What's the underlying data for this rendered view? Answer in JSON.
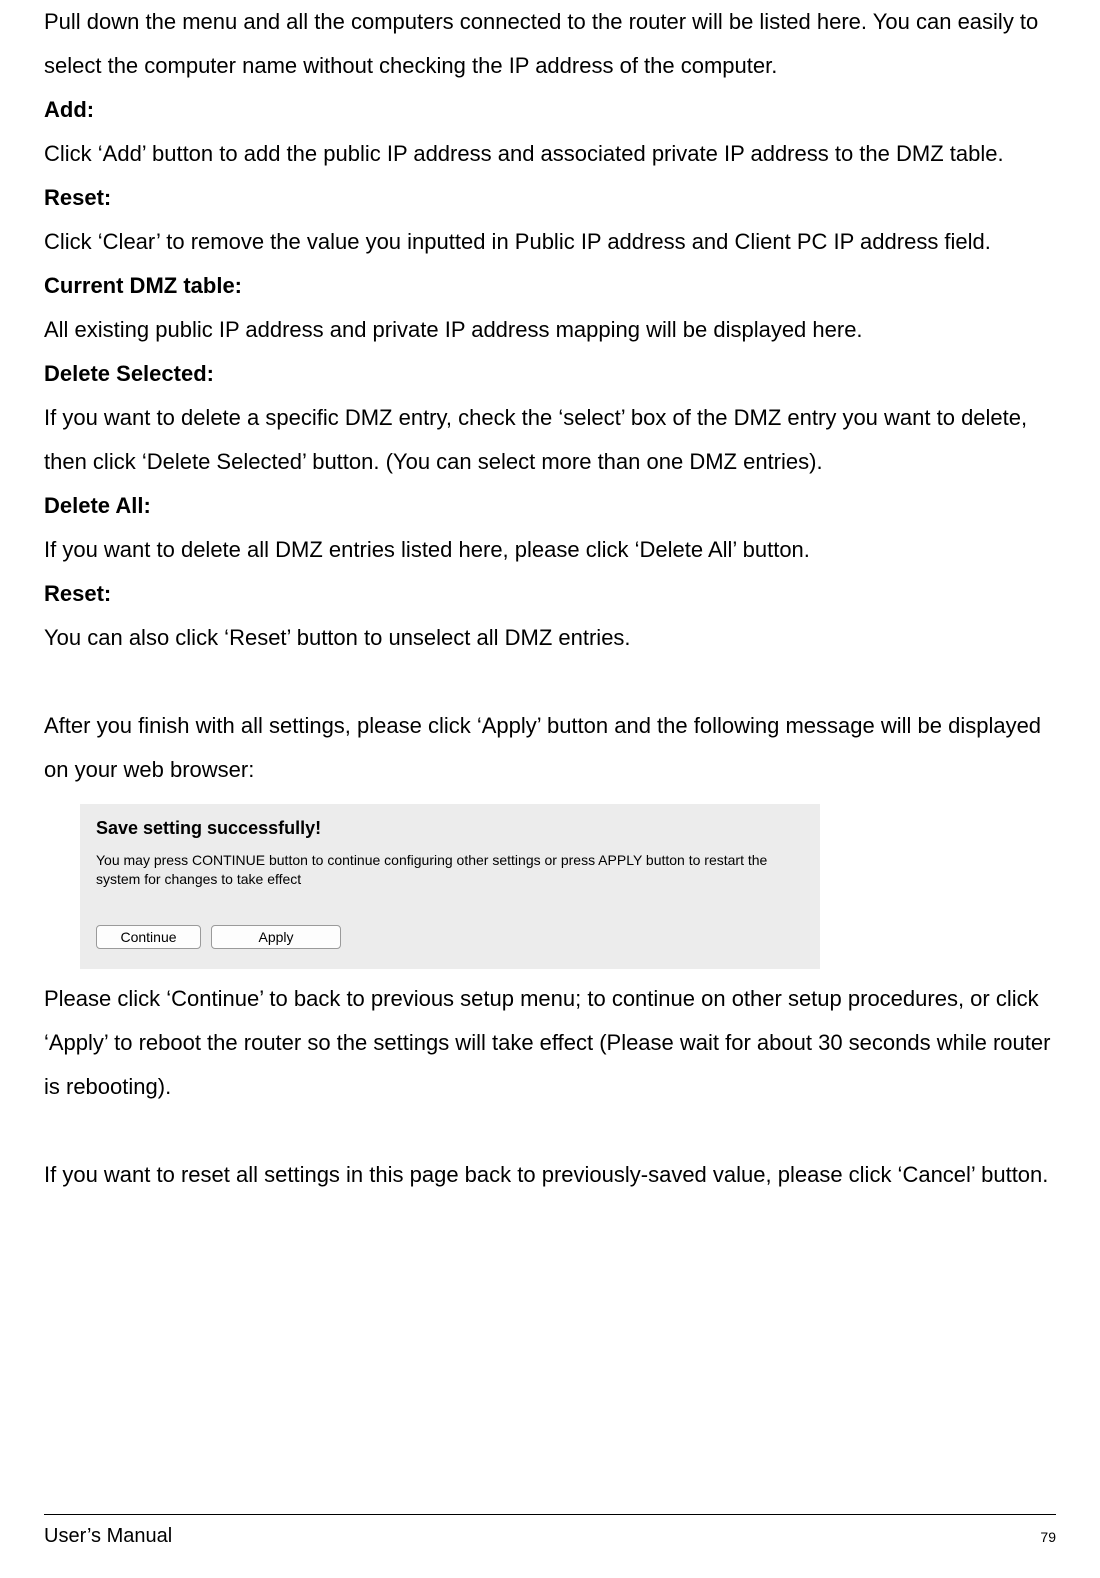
{
  "intro_text": "Pull down the menu and all the computers connected to the router will be listed here. You can easily to select the computer name without checking the IP address of the computer.",
  "sections": {
    "add": {
      "label": "Add:",
      "text": "Click ‘Add’ button to add the public IP address and associated private IP address to the DMZ table."
    },
    "reset1": {
      "label": "Reset:",
      "text": "Click ‘Clear’ to remove the value you inputted in Public IP address and Client PC IP address field."
    },
    "current_dmz": {
      "label": "Current DMZ table:",
      "text": "All existing public IP address and private IP address mapping will be displayed here."
    },
    "delete_selected": {
      "label": "Delete Selected:",
      "text": "If you want to delete a specific DMZ entry, check the ‘select’ box of the DMZ entry you want to delete, then click ‘Delete Selected’ button. (You can select more than one DMZ entries)."
    },
    "delete_all": {
      "label": "Delete All:",
      "text": "If you want to delete all DMZ entries listed here, please click ‘Delete All’ button."
    },
    "reset2": {
      "label": "Reset:",
      "text": "You can also click ‘Reset’ button to unselect all DMZ entries."
    }
  },
  "after_settings": "After you finish with all settings, please click ‘Apply’ button and the following message will be displayed on your web browser:",
  "screenshot": {
    "title": "Save setting successfully!",
    "desc": "You may press CONTINUE button to continue configuring other settings or press APPLY button to restart the system for changes to take effect",
    "continue_label": "Continue",
    "apply_label": "Apply"
  },
  "after_screenshot": "Please click ‘Continue’ to back to previous setup menu; to continue on other setup procedures, or click ‘Apply’ to reboot the router so the settings will take effect (Please wait for about 30 seconds while router is rebooting).",
  "reset_note": "If you want to reset all settings in this page back to previously-saved value, please click ‘Cancel’ button.",
  "footer": {
    "title": "User’s Manual",
    "page": "79"
  }
}
